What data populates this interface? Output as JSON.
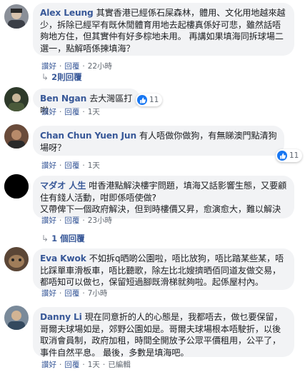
{
  "labels": {
    "like": "讚好",
    "reply": "回覆",
    "edited": "已編輯"
  },
  "comments": [
    {
      "author": "Alex Leung",
      "text": "其實香港已經係石屎森林，體用、文化用地越來越少，拆除已經罕有既休閒體育用地去起樓真係好可悲，雖然話唔夠地方住，但其實仲有好多棕地未用。 再講如果填海同拆球場二選一，點解唔係揀填海？",
      "time": "22小時",
      "replies": "2則回覆"
    },
    {
      "author": "Ben Ngan",
      "text": "去大灣區打啦",
      "time": "1天",
      "reactions": "11"
    },
    {
      "author": "Chan Chun Yuen Jun",
      "text": "有人唔做你做狗，有無睇澳門點清狗場呀？",
      "time": "1天",
      "reactions": "11"
    },
    {
      "author": "マダオ 人生",
      "text": "咁香港點解決樓宇問題，填海又話影響生態，又要顧住有錢人活動，咁即係唔使做?\n又帶俾下一個政府解決，但到時樓價又昇，愈演愈大，難以解決",
      "time": "23小時",
      "replies": "1 個回覆"
    },
    {
      "author": "Eva Kwok",
      "text": "不如拆q晒啲公園啦，唔比放狗，唔比踏某些某，唔比踩單車滑板車，唔比聽歌，除左比北嫂擠晒佰同道友做交易，都唔知可以做乜，保留短過腳既滑梯就夠啦。起係屋村內。",
      "time": "7小時"
    },
    {
      "author": "Danny Li",
      "text": "現在同意折的人的心態是，我都唔去，做乜要保留，哥爾夫球場如是，郊野公園如是。哥爾夫球場根本唔駛折，以後取消會員制，政府加租，時間全開放予公眾平價租用，公平了，事件自然平息。 最後，多數是填海吧。",
      "time": "1天"
    }
  ]
}
